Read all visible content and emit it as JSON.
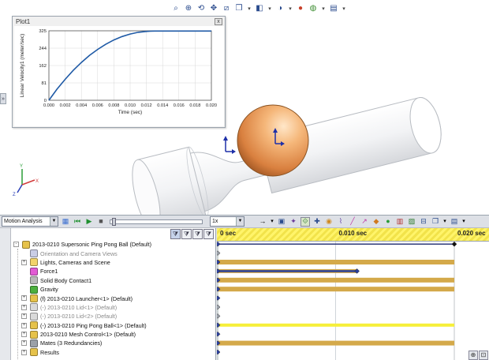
{
  "view_toolbar": {
    "icons": [
      "zoom-to-fit-icon",
      "zoom-to-area-icon",
      "previous-view-icon",
      "pan-icon",
      "section-view-icon",
      "view-orientation-icon",
      "display-style-icon",
      "hide-show-items-icon",
      "edit-appearance-icon",
      "apply-scene-icon",
      "view-settings-icon"
    ]
  },
  "plot": {
    "title": "Plot1",
    "close_label": "x",
    "chart_data": {
      "type": "line",
      "xlabel": "Time (sec)",
      "ylabel": "Linear Velocity1 (meter/sec)",
      "xlim": [
        0,
        0.02
      ],
      "ylim": [
        0,
        325
      ],
      "x_ticks": [
        "0.000",
        "0.002",
        "0.004",
        "0.006",
        "0.008",
        "0.010",
        "0.012",
        "0.014",
        "0.016",
        "0.018",
        "0.020"
      ],
      "y_ticks": [
        "0",
        "81",
        "162",
        "244",
        "325"
      ],
      "series_color": "#1f5aa6",
      "x": [
        0,
        0.001,
        0.002,
        0.003,
        0.004,
        0.005,
        0.006,
        0.007,
        0.008,
        0.009,
        0.01,
        0.011,
        0.012,
        0.0125,
        0.013,
        0.014,
        0.016,
        0.018,
        0.02
      ],
      "values": [
        0,
        52,
        98,
        140,
        177,
        210,
        238,
        262,
        282,
        298,
        310,
        318,
        322,
        323,
        324,
        324,
        324,
        324,
        324
      ]
    }
  },
  "motion_toolbar": {
    "study_type": "Motion Analysis",
    "speed": "1x",
    "icons": [
      "calculate-icon",
      "play-from-start-icon",
      "play-icon",
      "stop-icon"
    ],
    "right_icons": [
      "playback-mode-icon",
      "save-animation-icon",
      "animation-wizard-icon",
      "autokey-icon",
      "add-key-icon",
      "motor-icon",
      "spring-icon",
      "damper-icon",
      "force-icon",
      "contact-icon",
      "gravity-icon",
      "results-and-plots-icon",
      "motion-study-properties-icon",
      "collapse-icon"
    ]
  },
  "tree": {
    "filter_icons": [
      "filter-animated-icon",
      "filter-driving-icon",
      "filter-selected-icon",
      "filter-results-icon"
    ],
    "rows": [
      {
        "label": "2013-0210 Supersonic Ping Pong Ball  (Default)",
        "indent": 0,
        "grey": false,
        "icon": "assembly-icon",
        "icon_color": "#e6c24a",
        "expander": "-"
      },
      {
        "label": "Orientation and Camera Views",
        "indent": 1,
        "grey": true,
        "icon": "camera-views-icon",
        "icon_color": "#c9cde6",
        "expander": ""
      },
      {
        "label": "Lights, Cameras and Scene",
        "indent": 1,
        "grey": false,
        "icon": "lights-icon",
        "icon_color": "#f2d36b",
        "expander": "+"
      },
      {
        "label": "Force1",
        "indent": 1,
        "grey": false,
        "icon": "force-icon",
        "icon_color": "#e25bd4",
        "expander": ""
      },
      {
        "label": "Solid Body Contact1",
        "indent": 1,
        "grey": false,
        "icon": "contact-icon",
        "icon_color": "#b9b9b9",
        "expander": ""
      },
      {
        "label": "Gravity",
        "indent": 1,
        "grey": false,
        "icon": "gravity-icon",
        "icon_color": "#4caf3e",
        "expander": ""
      },
      {
        "label": "(f) 2013-0210 Launcher<1> (Default)",
        "indent": 1,
        "grey": false,
        "icon": "part-icon",
        "icon_color": "#e6c24a",
        "expander": "+"
      },
      {
        "label": "(-) 2013-0210 Lid<1> (Default)",
        "indent": 1,
        "grey": true,
        "icon": "part-icon",
        "icon_color": "#d9d9d9",
        "expander": "+"
      },
      {
        "label": "(-) 2013-0210 Lid<2> (Default)",
        "indent": 1,
        "grey": true,
        "icon": "part-icon",
        "icon_color": "#d9d9d9",
        "expander": "+"
      },
      {
        "label": "(-) 2013-0210 Ping Pong Ball<1> (Default)",
        "indent": 1,
        "grey": false,
        "icon": "part-icon",
        "icon_color": "#e6c24a",
        "expander": "+"
      },
      {
        "label": "2013-0210 Mesh Control<1> (Default)",
        "indent": 1,
        "grey": false,
        "icon": "part-icon",
        "icon_color": "#e6c24a",
        "expander": "+"
      },
      {
        "label": "Mates (3 Redundancies)",
        "indent": 1,
        "grey": false,
        "icon": "mates-icon",
        "icon_color": "#9aa0a8",
        "expander": "+"
      },
      {
        "label": "Results",
        "indent": 1,
        "grey": false,
        "icon": "results-icon",
        "icon_color": "#e6c24a",
        "expander": "+"
      }
    ]
  },
  "timeline": {
    "labels": [
      {
        "text": "0 sec",
        "t": 0.0
      },
      {
        "text": "0.010 sec",
        "t": 0.01
      },
      {
        "text": "0.020 sec",
        "t": 0.02
      }
    ],
    "end_time": 0.02,
    "playhead_time": 0.0,
    "colors": {
      "bar": "#d4a94a",
      "bright": "#f6ef3a",
      "blue": "#233d9c",
      "line": "#1c2a6e"
    }
  }
}
